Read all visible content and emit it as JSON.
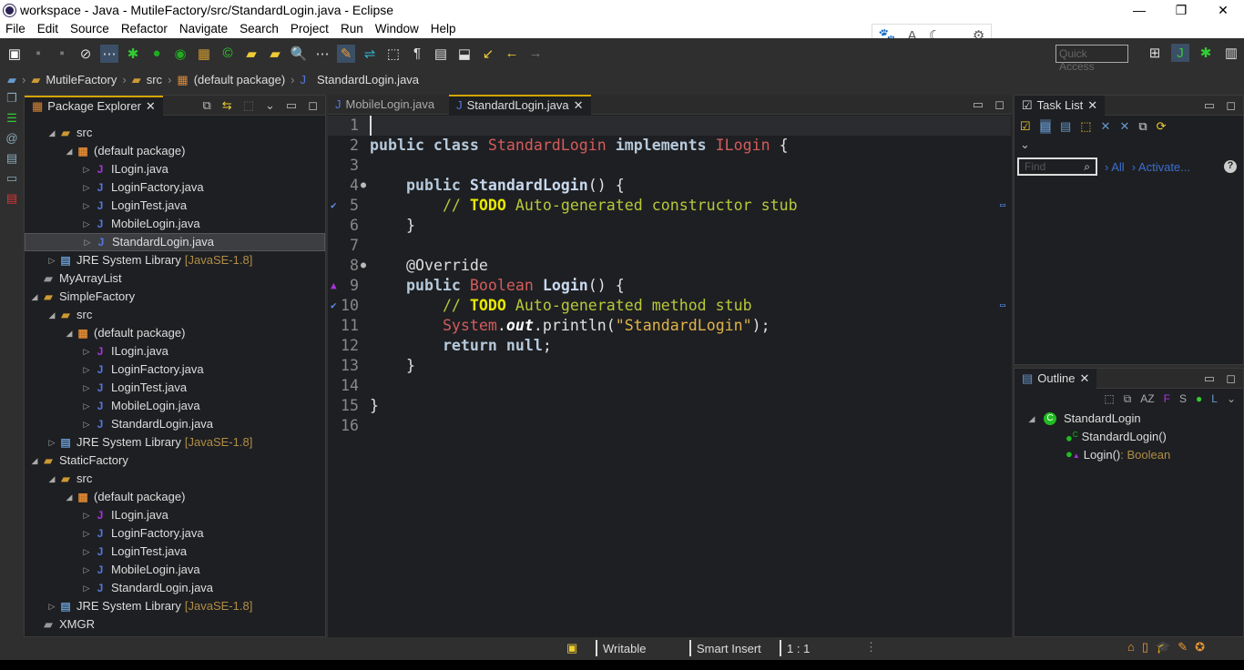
{
  "window": {
    "title": "workspace - Java - MutileFactory/src/StandardLogin.java - Eclipse",
    "controls": [
      "—",
      "❐",
      "✕"
    ]
  },
  "menu": [
    "File",
    "Edit",
    "Source",
    "Refactor",
    "Navigate",
    "Search",
    "Project",
    "Run",
    "Window",
    "Help"
  ],
  "quick_access": {
    "placeholder": "Quick Access"
  },
  "breadcrumb": [
    "MutileFactory",
    "src",
    "(default package)",
    "StandardLogin.java"
  ],
  "package_explorer": {
    "title": "Package Explorer",
    "rows": [
      {
        "level": 1,
        "label": "src",
        "icon": "source-folder",
        "arrow": "open"
      },
      {
        "level": 2,
        "label": "(default package)",
        "icon": "package",
        "arrow": "open"
      },
      {
        "level": 3,
        "label": "ILogin.java",
        "icon": "interface-file",
        "arrow": "closed"
      },
      {
        "level": 3,
        "label": "LoginFactory.java",
        "icon": "java-file",
        "arrow": "closed"
      },
      {
        "level": 3,
        "label": "LoginTest.java",
        "icon": "java-file",
        "arrow": "closed"
      },
      {
        "level": 3,
        "label": "MobileLogin.java",
        "icon": "java-file",
        "arrow": "closed"
      },
      {
        "level": 3,
        "label": "StandardLogin.java",
        "icon": "java-file",
        "arrow": "closed",
        "selected": true
      },
      {
        "level": 1,
        "label": "JRE System Library",
        "lib": "[JavaSE-1.8]",
        "icon": "library",
        "arrow": "closed"
      },
      {
        "level": 0,
        "label": "MyArrayList",
        "icon": "folder",
        "arrow": ""
      },
      {
        "level": 0,
        "label": "SimpleFactory",
        "icon": "project",
        "arrow": "open"
      },
      {
        "level": 1,
        "label": "src",
        "icon": "source-folder",
        "arrow": "open"
      },
      {
        "level": 2,
        "label": "(default package)",
        "icon": "package",
        "arrow": "open"
      },
      {
        "level": 3,
        "label": "ILogin.java",
        "icon": "interface-file",
        "arrow": "closed"
      },
      {
        "level": 3,
        "label": "LoginFactory.java",
        "icon": "java-file",
        "arrow": "closed"
      },
      {
        "level": 3,
        "label": "LoginTest.java",
        "icon": "java-file",
        "arrow": "closed"
      },
      {
        "level": 3,
        "label": "MobileLogin.java",
        "icon": "java-file",
        "arrow": "closed"
      },
      {
        "level": 3,
        "label": "StandardLogin.java",
        "icon": "java-file",
        "arrow": "closed"
      },
      {
        "level": 1,
        "label": "JRE System Library",
        "lib": "[JavaSE-1.8]",
        "icon": "library",
        "arrow": "closed"
      },
      {
        "level": 0,
        "label": "StaticFactory",
        "icon": "project",
        "arrow": "open"
      },
      {
        "level": 1,
        "label": "src",
        "icon": "source-folder",
        "arrow": "open"
      },
      {
        "level": 2,
        "label": "(default package)",
        "icon": "package",
        "arrow": "open"
      },
      {
        "level": 3,
        "label": "ILogin.java",
        "icon": "interface-file",
        "arrow": "closed"
      },
      {
        "level": 3,
        "label": "LoginFactory.java",
        "icon": "java-file",
        "arrow": "closed"
      },
      {
        "level": 3,
        "label": "LoginTest.java",
        "icon": "java-file",
        "arrow": "closed"
      },
      {
        "level": 3,
        "label": "MobileLogin.java",
        "icon": "java-file",
        "arrow": "closed"
      },
      {
        "level": 3,
        "label": "StandardLogin.java",
        "icon": "java-file",
        "arrow": "closed"
      },
      {
        "level": 1,
        "label": "JRE System Library",
        "lib": "[JavaSE-1.8]",
        "icon": "library",
        "arrow": "closed"
      },
      {
        "level": 0,
        "label": "XMGR",
        "icon": "folder",
        "arrow": ""
      }
    ]
  },
  "editor": {
    "tabs": [
      {
        "label": "MobileLogin.java",
        "active": false
      },
      {
        "label": "StandardLogin.java",
        "active": true
      }
    ],
    "lines": [
      {
        "n": "1",
        "marker": "",
        "tokens": []
      },
      {
        "n": "2",
        "marker": "",
        "tokens": [
          [
            "kw",
            "public class "
          ],
          [
            "cls",
            "StandardLogin"
          ],
          [
            "kw",
            " implements "
          ],
          [
            "cls",
            "ILogin"
          ],
          [
            "plain",
            " {"
          ]
        ]
      },
      {
        "n": "3",
        "marker": "",
        "tokens": []
      },
      {
        "n": "4",
        "marker": "fold",
        "tokens": [
          [
            "plain",
            "    "
          ],
          [
            "kw",
            "public "
          ],
          [
            "mth",
            "StandardLogin"
          ],
          [
            "plain",
            "() {"
          ]
        ]
      },
      {
        "n": "5",
        "marker": "task",
        "tokens": [
          [
            "plain",
            "        "
          ],
          [
            "cm",
            "// "
          ],
          [
            "todo",
            "TODO"
          ],
          [
            "cm",
            " Auto-generated constructor stub"
          ]
        ]
      },
      {
        "n": "6",
        "marker": "",
        "tokens": [
          [
            "plain",
            "    }"
          ]
        ]
      },
      {
        "n": "7",
        "marker": "",
        "tokens": []
      },
      {
        "n": "8",
        "marker": "fold",
        "tokens": [
          [
            "plain",
            "    "
          ],
          [
            "ann",
            "@Override"
          ]
        ]
      },
      {
        "n": "9",
        "marker": "override",
        "tokens": [
          [
            "plain",
            "    "
          ],
          [
            "kw",
            "public "
          ],
          [
            "cls",
            "Boolean "
          ],
          [
            "mth",
            "Login"
          ],
          [
            "plain",
            "() {"
          ]
        ]
      },
      {
        "n": "10",
        "marker": "task",
        "tokens": [
          [
            "plain",
            "        "
          ],
          [
            "cm",
            "// "
          ],
          [
            "todo",
            "TODO"
          ],
          [
            "cm",
            " Auto-generated method stub"
          ]
        ]
      },
      {
        "n": "11",
        "marker": "",
        "tokens": [
          [
            "plain",
            "        "
          ],
          [
            "cls",
            "System"
          ],
          [
            "plain",
            "."
          ],
          [
            "fld",
            "out"
          ],
          [
            "plain",
            ".println("
          ],
          [
            "str",
            "\"StandardLogin\""
          ],
          [
            "plain",
            ");"
          ]
        ]
      },
      {
        "n": "12",
        "marker": "",
        "tokens": [
          [
            "plain",
            "        "
          ],
          [
            "kw",
            "return null"
          ],
          [
            "plain",
            ";"
          ]
        ]
      },
      {
        "n": "13",
        "marker": "",
        "tokens": [
          [
            "plain",
            "    }"
          ]
        ]
      },
      {
        "n": "14",
        "marker": "",
        "tokens": []
      },
      {
        "n": "15",
        "marker": "",
        "tokens": [
          [
            "plain",
            "}"
          ]
        ]
      },
      {
        "n": "16",
        "marker": "",
        "tokens": []
      }
    ]
  },
  "task_list": {
    "title": "Task List",
    "find_placeholder": "Find",
    "all_link": "All",
    "activate_link": "Activate..."
  },
  "outline": {
    "title": "Outline",
    "items": [
      {
        "label": "StandardLogin",
        "type": ""
      },
      {
        "label": "StandardLogin()",
        "type": ""
      },
      {
        "label": "Login()",
        "type": " : Boolean"
      }
    ]
  },
  "status": {
    "writable": "Writable",
    "insert_mode": "Smart Insert",
    "position": "1 : 1"
  }
}
